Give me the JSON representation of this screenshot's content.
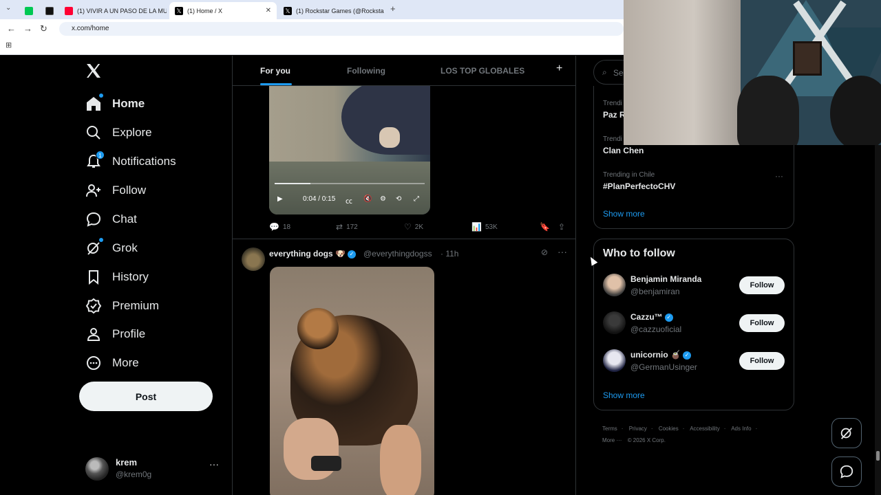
{
  "browser": {
    "tabs": [
      {
        "title": "",
        "favicon_color": "#00c853"
      },
      {
        "title": "",
        "favicon_color": "#111111"
      },
      {
        "title": "(1) VIVIR A UN PASO DE LA MU",
        "favicon_color": "#ff0033"
      },
      {
        "title": "(1) Home / X",
        "favicon_color": "#000000"
      },
      {
        "title": "(1) Rockstar Games (@Rocksta",
        "favicon_color": "#000000"
      }
    ],
    "url": "x.com/home",
    "new_tab": "+"
  },
  "nav": {
    "items": [
      {
        "label": "Home",
        "icon": "home-icon"
      },
      {
        "label": "Explore",
        "icon": "search-icon"
      },
      {
        "label": "Notifications",
        "icon": "bell-icon",
        "badge": "1"
      },
      {
        "label": "Follow",
        "icon": "person-add-icon"
      },
      {
        "label": "Chat",
        "icon": "chat-icon"
      },
      {
        "label": "Grok",
        "icon": "grok-icon"
      },
      {
        "label": "History",
        "icon": "bookmark-icon"
      },
      {
        "label": "Premium",
        "icon": "verified-icon"
      },
      {
        "label": "Profile",
        "icon": "person-icon"
      },
      {
        "label": "More",
        "icon": "more-circle-icon"
      }
    ],
    "post_label": "Post",
    "account": {
      "name": "krem",
      "handle": "@krem0g"
    }
  },
  "timeline": {
    "tabs": [
      "For you",
      "Following",
      "LOS TOP GLOBALES"
    ],
    "active_tab": "For you",
    "tweet1": {
      "video_time": "0:04 / 0:15",
      "progress": 0.24,
      "replies": "18",
      "reposts": "172",
      "likes": "2K",
      "views": "53K"
    },
    "tweet2": {
      "name": "everything dogs 🐶",
      "handle": "@everythingdogss",
      "time": "· 11h"
    }
  },
  "sidebar": {
    "search_placeholder": "Se",
    "trends": [
      {
        "meta": "Trendi",
        "title": "Paz R"
      },
      {
        "meta": "Trendi",
        "title": "Clan Chen"
      },
      {
        "meta": "Trending in Chile",
        "title": "#PlanPerfectoCHV"
      }
    ],
    "trends_show_more": "Show more",
    "who_to_follow_title": "Who to follow",
    "follow_suggestions": [
      {
        "name": "Benjamin Miranda",
        "handle": "@benjamiran",
        "verified": false,
        "button": "Follow"
      },
      {
        "name": "Cazzu™",
        "handle": "@cazzuoficial",
        "verified": true,
        "button": "Follow"
      },
      {
        "name": "unicornio 🧉",
        "handle": "@GermanUsinger",
        "verified": true,
        "button": "Follow"
      }
    ],
    "wtf_show_more": "Show more",
    "footer": [
      "Terms",
      "·",
      "Privacy",
      "·",
      "Cookies",
      "·",
      "Accessibility",
      "·",
      "Ads Info",
      "·",
      "More ···",
      "© 2026 X Corp."
    ]
  },
  "colors": {
    "accent": "#1d9bf0",
    "background": "#000000",
    "text": "#e7e9ea",
    "muted": "#71767b",
    "border": "#2f3336"
  }
}
